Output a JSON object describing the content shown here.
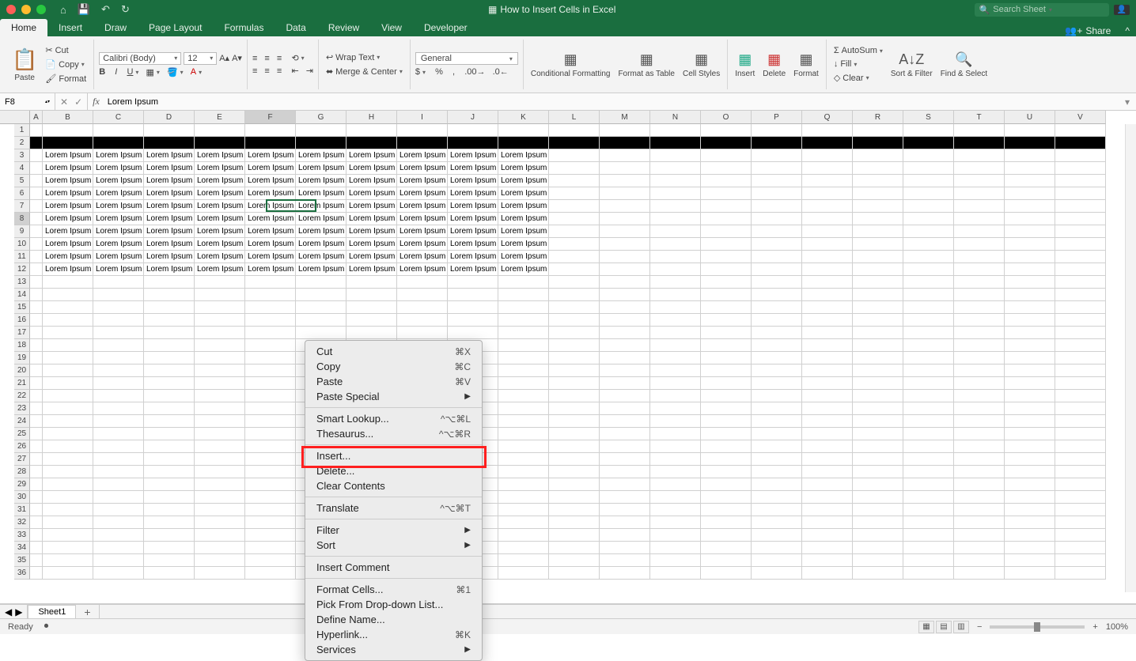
{
  "titlebar": {
    "title": "How to Insert Cells in Excel",
    "search_placeholder": "Search Sheet"
  },
  "ribbon_tabs": [
    "Home",
    "Insert",
    "Draw",
    "Page Layout",
    "Formulas",
    "Data",
    "Review",
    "View",
    "Developer"
  ],
  "ribbon_active_tab": "Home",
  "share_label": "Share",
  "ribbon": {
    "paste": "Paste",
    "cut": "Cut",
    "copy": "Copy",
    "format_painter": "Format",
    "font_name": "Calibri (Body)",
    "font_size": "12",
    "wrap_text": "Wrap Text",
    "merge_center": "Merge & Center",
    "number_format": "General",
    "conditional": "Conditional Formatting",
    "format_table": "Format as Table",
    "cell_styles": "Cell Styles",
    "insert": "Insert",
    "delete": "Delete",
    "format": "Format",
    "autosum": "AutoSum",
    "fill": "Fill",
    "clear": "Clear",
    "sort_filter": "Sort & Filter",
    "find_select": "Find & Select"
  },
  "formula_bar": {
    "name_box": "F8",
    "formula": "Lorem Ipsum"
  },
  "columns": [
    "A",
    "B",
    "C",
    "D",
    "E",
    "F",
    "G",
    "H",
    "I",
    "J",
    "K",
    "L",
    "M",
    "N",
    "O",
    "P",
    "Q",
    "R",
    "S",
    "T",
    "U",
    "V"
  ],
  "rows": [
    1,
    2,
    3,
    4,
    5,
    6,
    7,
    8,
    9,
    10,
    11,
    12,
    13,
    14,
    15,
    16,
    17,
    18,
    19,
    20,
    21,
    22,
    23,
    24,
    25,
    26,
    27,
    28,
    29,
    30,
    31,
    32,
    33,
    34,
    35,
    36
  ],
  "cell_text": "Lorem Ipsum",
  "context_menu": {
    "groups": [
      [
        {
          "label": "Cut",
          "shortcut": "⌘X"
        },
        {
          "label": "Copy",
          "shortcut": "⌘C"
        },
        {
          "label": "Paste",
          "shortcut": "⌘V"
        },
        {
          "label": "Paste Special",
          "submenu": true
        }
      ],
      [
        {
          "label": "Smart Lookup...",
          "shortcut": "^⌥⌘L"
        },
        {
          "label": "Thesaurus...",
          "shortcut": "^⌥⌘R"
        }
      ],
      [
        {
          "label": "Insert..."
        },
        {
          "label": "Delete..."
        },
        {
          "label": "Clear Contents"
        }
      ],
      [
        {
          "label": "Translate",
          "shortcut": "^⌥⌘T"
        }
      ],
      [
        {
          "label": "Filter",
          "submenu": true
        },
        {
          "label": "Sort",
          "submenu": true
        }
      ],
      [
        {
          "label": "Insert Comment"
        }
      ],
      [
        {
          "label": "Format Cells...",
          "shortcut": "⌘1"
        },
        {
          "label": "Pick From Drop-down List..."
        },
        {
          "label": "Define Name..."
        },
        {
          "label": "Hyperlink...",
          "shortcut": "⌘K"
        },
        {
          "label": "Services",
          "submenu": true
        }
      ]
    ]
  },
  "sheet_tab": "Sheet1",
  "status": {
    "ready": "Ready",
    "zoom": "100%"
  }
}
